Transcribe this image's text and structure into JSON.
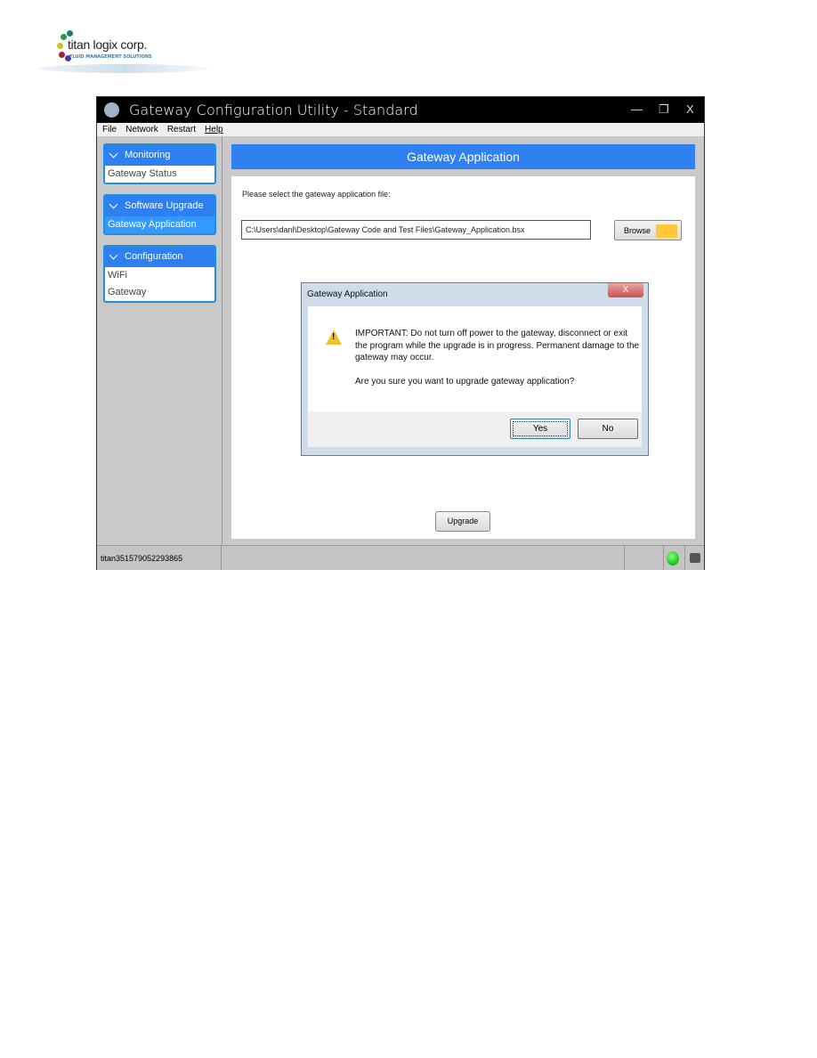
{
  "logo": {
    "brand": "titan logix corp.",
    "tagline": "FLUID MANAGEMENT SOLUTIONS"
  },
  "window": {
    "title": "Gateway Configuration Utility - Standard",
    "controls": {
      "minimize": "—",
      "maximize": "❐",
      "close": "X"
    }
  },
  "menu": [
    "File",
    "Network",
    "Restart",
    "Help"
  ],
  "sidebar": [
    {
      "header": "Monitoring",
      "items": [
        "Gateway Status"
      ]
    },
    {
      "header": "Software Upgrade",
      "items": [
        "Gateway Application"
      ],
      "selected": "Gateway Application"
    },
    {
      "header": "Configuration",
      "items": [
        "WiFi",
        "Gateway"
      ]
    }
  ],
  "main": {
    "title": "Gateway Application",
    "prompt": "Please select the gateway application file:",
    "file_path": "C:\\Users\\danl\\Desktop\\Gateway Code and Test Files\\Gateway_Application.bsx",
    "browse_label": "Browse",
    "upgrade_label": "Upgrade"
  },
  "dialog": {
    "title": "Gateway Application",
    "close": "X",
    "message": "IMPORTANT: Do not turn off power to the gateway, disconnect or exit the program while the upgrade is in progress. Permanent damage to the gateway may occur.",
    "question": "Are you sure you want to upgrade gateway application?",
    "yes": "Yes",
    "no": "No"
  },
  "status": {
    "device_id": "titan351579052293865",
    "connection": "connected",
    "connection_color": "#22cc22"
  }
}
